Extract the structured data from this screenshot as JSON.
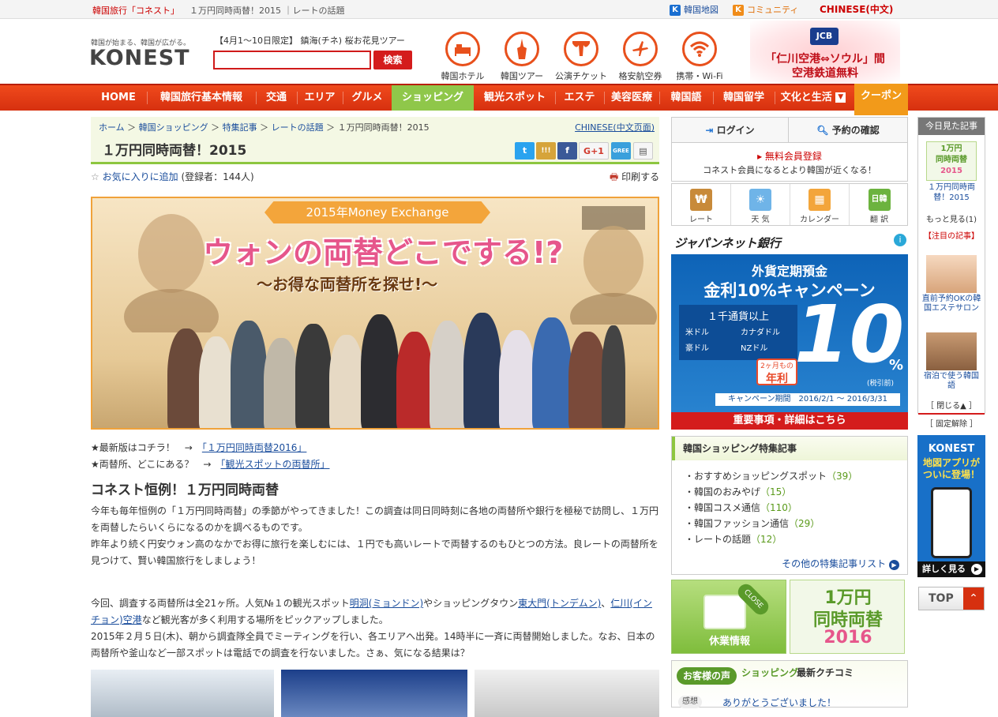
{
  "topbar": {
    "left_label": "韓国旅行「コネスト」",
    "breadcrumb_text": "１万円同時両替！2015 ｜レートの話題",
    "links": [
      {
        "label": "韓国地図",
        "badge": "K",
        "color": "#1a6fd1"
      },
      {
        "label": "コミュニティ",
        "badge": "K",
        "color": "#f08c1a"
      },
      {
        "label": "CHINESE(中文)",
        "badge": "",
        "color": "#c00"
      }
    ]
  },
  "header": {
    "tagline": "韓国が始まる、韓国が広がる。",
    "logo": "KONEST",
    "promo": "【4月1～10日限定】 鎮海(チネ) 桜お花見ツアー",
    "search": {
      "value": "",
      "button": "検索"
    },
    "services": [
      {
        "label": "韓国ホテル",
        "icon": "bed-icon"
      },
      {
        "label": "韓国ツアー",
        "icon": "tower-icon"
      },
      {
        "label": "公演チケット",
        "icon": "stage-icon"
      },
      {
        "label": "格安航空券",
        "icon": "airplane-icon"
      },
      {
        "label": "携帯・Wi-Fi",
        "icon": "wifi-icon"
      }
    ],
    "jcb": {
      "logo": "JCB",
      "line1": "「仁川空港⇔ソウル」間",
      "line2": "空港鉄道無料"
    }
  },
  "nav": [
    "HOME",
    "韓国旅行基本情報",
    "交通",
    "エリア",
    "グルメ",
    "ショッピング",
    "観光スポット",
    "エステ",
    "美容医療",
    "韓国語",
    "韓国留学",
    "文化と生活",
    "クーポン"
  ],
  "content": {
    "breadcrumb": [
      "ホーム",
      "韓国ショッピング",
      "特集記事",
      "レートの話題",
      "１万円同時両替！2015"
    ],
    "chinese_link": "CHINESE(中文页面)",
    "title": "１万円同時両替！2015",
    "share": [
      {
        "name": "twitter",
        "label": "t",
        "color": "#2aa3ef"
      },
      {
        "name": "mixi",
        "label": "!!!",
        "color": "#d6a43a"
      },
      {
        "name": "facebook",
        "label": "f",
        "color": "#3b5998"
      },
      {
        "name": "google-plus",
        "label": "G+1",
        "color": "#e8e8e8"
      },
      {
        "name": "gree",
        "label": "GREE",
        "color": "#3aa0dc"
      },
      {
        "name": "note",
        "label": "▤",
        "color": "#e8e8e8"
      }
    ],
    "favorite": "お気に入りに追加",
    "favorite_count": "(登録者：144人)",
    "print": "印刷する",
    "hero": {
      "banner": "2015年Money Exchange",
      "headline": "ウォンの両替どこでする!?",
      "subhead": "～お得な両替所を探せ!～"
    },
    "links": [
      {
        "prefix": "★最新版はコチラ！　→　",
        "link": "「１万円同時両替2016」"
      },
      {
        "prefix": "★両替所、どこにある？　→　",
        "link": "「観光スポットの両替所」"
      }
    ],
    "section_title": "コネスト恒例！１万円同時両替",
    "para1": "今年も毎年恒例の「１万円同時両替」の季節がやってきました！この調査は同日同時刻に各地の両替所や銀行を極秘で訪問し、１万円を両替したらいくらになるのかを調べるものです。",
    "para2": "昨年より続く円安ウォン高のなかでお得に旅行を楽しむには、１円でも高いレートで両替するのもひとつの方法。良レートの両替所を見つけて、賢い韓国旅行をしましょう！",
    "para3_a": "今回、調査する両替所は全21ヶ所。人気№１の観光スポット",
    "para3_link1": "明洞(ミョンドン)",
    "para3_b": "やショッピングタウン",
    "para3_link2": "東大門(トンデムン)",
    "para3_c": "、",
    "para3_link3": "仁川(インチョン)空港",
    "para3_d": "など観光客が多く利用する場所をピックアップしました。",
    "para4": "2015年２月５日(木)、朝から調査隊全員でミーティングを行い、各エリアへ出発。14時半に一斉に両替開始しました。なお、日本の両替所や釜山など一部スポットは電話での調査を行ないました。さぁ、気になる結果は？"
  },
  "sidebar": {
    "login": "ログイン",
    "reservation": "予約の確認",
    "register": "無料会員登録",
    "register_sub": "コネスト会員になるとより韓国が近くなる！",
    "tools": [
      {
        "label": "レート",
        "glyph": "₩",
        "color": "#c88a3a"
      },
      {
        "label": "天 気",
        "glyph": "☀",
        "color": "#6fb4e8"
      },
      {
        "label": "カレンダー",
        "glyph": "▦",
        "color": "#f3a53b"
      },
      {
        "label": "翻 訳",
        "glyph": "日韓",
        "color": "#6cb33f"
      }
    ],
    "ad": {
      "bank": "ジャパンネット銀行",
      "line1": "外貨定期預金",
      "line2": "金利10%キャンペーン",
      "cond": "１千通貨以上",
      "currencies": [
        "米ドル",
        "カナダドル",
        "豪ドル",
        "NZドル"
      ],
      "rate": "10",
      "rate_unit": "%",
      "rate_note": "(税引前)",
      "period_tag": "2ヶ月もの",
      "period_tag2": "年利",
      "campaign": "キャンペーン期間　2016/2/1 ～ 2016/3/31",
      "footer": "重要事項・詳細はこちら"
    },
    "feature": {
      "title": "韓国ショッピング特集記事",
      "items": [
        {
          "label": "おすすめショッピングスポット",
          "count": "（39）"
        },
        {
          "label": "韓国のおみやげ",
          "count": "（15）"
        },
        {
          "label": "韓国コスメ通信",
          "count": "（110）"
        },
        {
          "label": "韓国ファッション通信",
          "count": "（29）"
        },
        {
          "label": "レートの話題",
          "count": "（12）"
        }
      ],
      "more": "その他の特集記事リスト"
    },
    "banner_closed": "休業情報",
    "banner_closed_tag": "CLOSE",
    "banner_exchange": [
      "1万円",
      "同時両替",
      "2016"
    ],
    "kuchikomi_badge": "お客様の声",
    "kuchikomi_title": "ショッピング",
    "kuchikomi_sub": "最新クチコミ",
    "kuchikomi_first": "ありがとうございました！",
    "kuchikomi_badge2": "感想"
  },
  "rail": {
    "header": "今日見た記事",
    "item1_thumb": [
      "1万円",
      "同時両替",
      "2015"
    ],
    "item1": "１万円同時両替！2015",
    "more": "もっと見る(1)",
    "notice": "【注目の記事】",
    "item2": "直前予約OKの韓国エステサロン",
    "item3": "宿泊で使う韓国語",
    "close": "［ 閉じる▲ ］",
    "unpin": "［ 固定解除 ］",
    "app_logo": "KONEST",
    "app_text": "地図アプリがついに登場！",
    "app_more": "詳しく見る",
    "top": "TOP"
  }
}
